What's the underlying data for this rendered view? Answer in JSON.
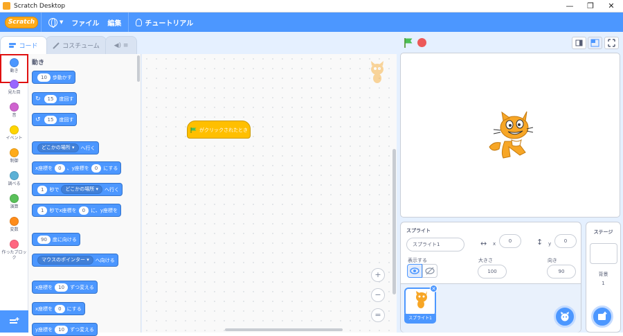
{
  "window": {
    "title": "Scratch Desktop",
    "controls": [
      "—",
      "❐",
      "✕"
    ]
  },
  "menubar": {
    "logo": "Scratch",
    "file": "ファイル",
    "edit": "編集",
    "tutorials": "チュートリアル"
  },
  "tabs": {
    "code": "コード",
    "costumes": "コスチューム",
    "sounds": ""
  },
  "categories": [
    {
      "label": "動き",
      "color": "#4c97ff"
    },
    {
      "label": "見た目",
      "color": "#9966ff"
    },
    {
      "label": "音",
      "color": "#cf63cf"
    },
    {
      "label": "イベント",
      "color": "#ffd500"
    },
    {
      "label": "制御",
      "color": "#ffab19"
    },
    {
      "label": "調べる",
      "color": "#5cb1d6"
    },
    {
      "label": "演算",
      "color": "#59c059"
    },
    {
      "label": "変数",
      "color": "#ff8c1a"
    },
    {
      "label": "作ったブロック",
      "color": "#ff6680"
    }
  ],
  "palette": {
    "heading": "動き",
    "move": {
      "v": "10",
      "t": "歩動かす"
    },
    "turn_right": {
      "v": "15",
      "t": "度回す"
    },
    "turn_left": {
      "v": "15",
      "t": "度回す"
    },
    "goto": {
      "d": "どこかの場所",
      "t": "へ行く"
    },
    "gotoxy": {
      "a": "x座標を",
      "x": "0",
      "b": "、y座標を",
      "y": "0",
      "c": "にする"
    },
    "glide": {
      "v": "1",
      "a": "秒で",
      "d": "どこかの場所",
      "t": "へ行く"
    },
    "glidexy": {
      "v": "1",
      "a": "秒でx座標を",
      "x": "0",
      "b": "に、y座標を"
    },
    "point": {
      "v": "90",
      "t": "度に向ける"
    },
    "pointto": {
      "d": "マウスのポインター",
      "t": "へ向ける"
    },
    "changex": {
      "a": "x座標を",
      "v": "10",
      "t": "ずつ変える"
    },
    "setx": {
      "a": "x座標を",
      "v": "0",
      "t": "にする"
    },
    "changey": {
      "a": "y座標を",
      "v": "10",
      "t": "ずつ変える"
    }
  },
  "script": {
    "hat": "がクリックされたとき"
  },
  "zoom": [
    "+",
    "−",
    "="
  ],
  "sprite": {
    "heading": "スプライト",
    "name": "スプライト1",
    "x_label": "x",
    "x": "0",
    "y_label": "y",
    "y": "0",
    "show_label": "表示する",
    "size_label": "大きさ",
    "size": "100",
    "dir_label": "向き",
    "direction": "90",
    "thumb_label": "スプライト1"
  },
  "stage_panel": {
    "heading": "ステージ",
    "backdrops_label": "背景",
    "backdrops": "1"
  }
}
